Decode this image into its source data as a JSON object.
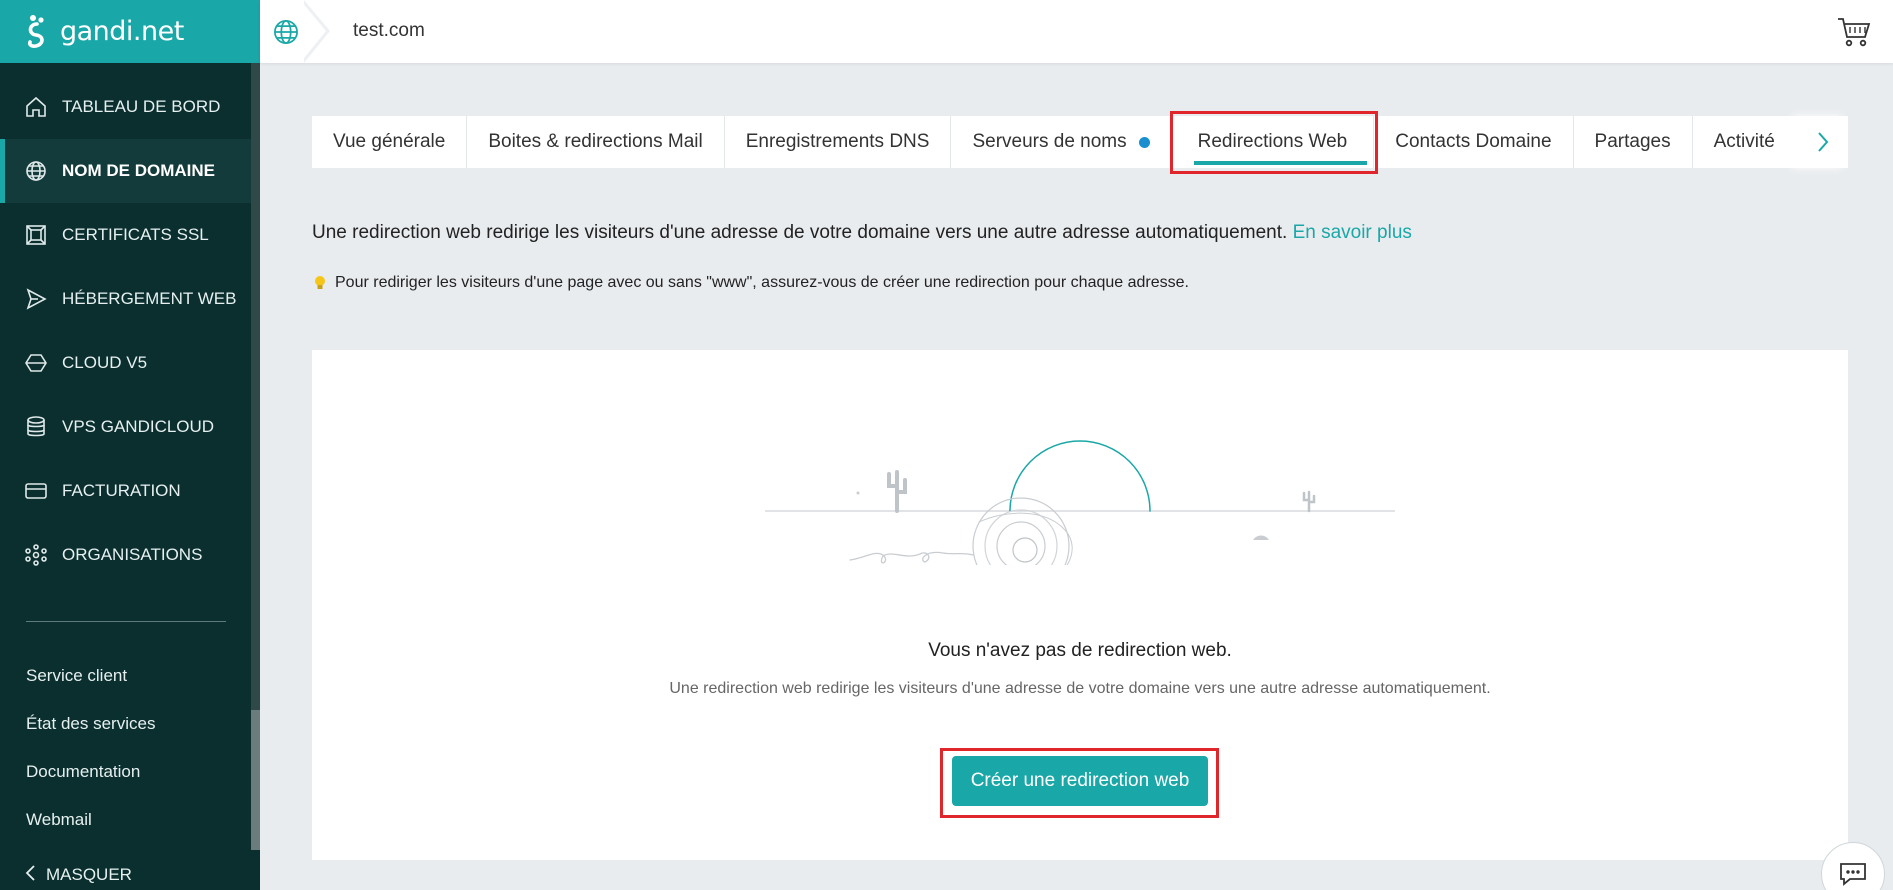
{
  "brand": {
    "name": "gandi.net",
    "accent": "#1aa7a7",
    "sidebar_bg": "#0b2e2e"
  },
  "sidebar": {
    "items": [
      {
        "label": "TABLEAU DE BORD",
        "icon": "home-icon",
        "active": false
      },
      {
        "label": "NOM DE DOMAINE",
        "icon": "globe-icon",
        "active": true
      },
      {
        "label": "CERTIFICATS SSL",
        "icon": "certificate-icon",
        "active": false
      },
      {
        "label": "HÉBERGEMENT WEB",
        "icon": "send-icon",
        "active": false
      },
      {
        "label": "CLOUD V5",
        "icon": "cube-icon",
        "active": false
      },
      {
        "label": "VPS GANDICLOUD",
        "icon": "server-stack-icon",
        "active": false
      },
      {
        "label": "FACTURATION",
        "icon": "credit-card-icon",
        "active": false
      },
      {
        "label": "ORGANISATIONS",
        "icon": "network-icon",
        "active": false
      }
    ],
    "links": [
      "Service client",
      "État des services",
      "Documentation",
      "Webmail"
    ],
    "collapse_label": "MASQUER"
  },
  "header": {
    "domain": "test.com"
  },
  "tabs": [
    {
      "label": "Vue générale"
    },
    {
      "label": "Boites & redirections Mail"
    },
    {
      "label": "Enregistrements DNS"
    },
    {
      "label": "Serveurs de noms",
      "badge": true
    },
    {
      "label": "Redirections Web",
      "active": true
    },
    {
      "label": "Contacts Domaine"
    },
    {
      "label": "Partages"
    },
    {
      "label": "Activité"
    }
  ],
  "intro": {
    "text": "Une redirection web redirige les visiteurs d'une adresse de votre domaine vers une autre adresse automatiquement.",
    "link": "En savoir plus"
  },
  "tip": "Pour rediriger les visiteurs d'une page avec ou sans \"www\", assurez-vous de créer une redirection pour chaque adresse.",
  "empty_state": {
    "title": "Vous n'avez pas de redirection web.",
    "subtitle": "Une redirection web redirige les visiteurs d'une adresse de votre domaine vers une autre adresse automatiquement.",
    "button": "Créer une redirection web"
  }
}
